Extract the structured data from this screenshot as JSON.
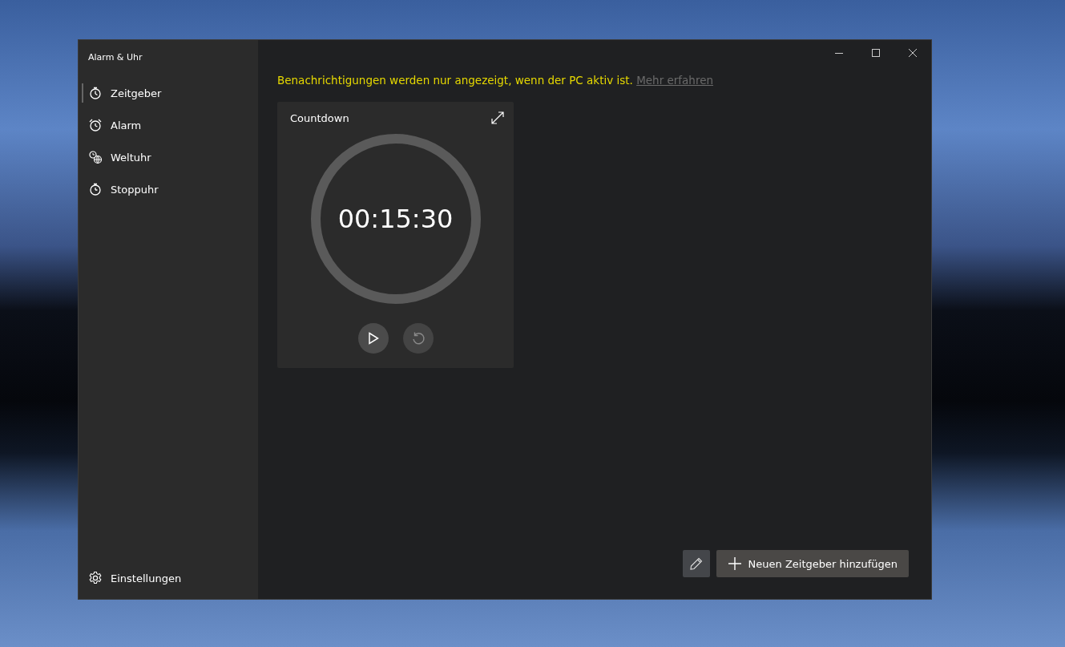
{
  "window": {
    "title": "Alarm & Uhr"
  },
  "nav": [
    {
      "label": "Zeitgeber",
      "selected": true
    },
    {
      "label": "Alarm",
      "selected": false
    },
    {
      "label": "Weltuhr",
      "selected": false
    },
    {
      "label": "Stoppuhr",
      "selected": false
    }
  ],
  "settings": {
    "label": "Einstellungen"
  },
  "notice": {
    "text": "Benachrichtigungen werden nur angezeigt, wenn der PC aktiv ist.",
    "link": "Mehr erfahren"
  },
  "timers": [
    {
      "title": "Countdown",
      "time": "00:15:30",
      "controls": [
        {
          "kind": "play",
          "disabled": false
        },
        {
          "kind": "reset",
          "disabled": true
        }
      ]
    }
  ],
  "add_button": {
    "label": "Neuen Zeitgeber hinzufügen"
  }
}
